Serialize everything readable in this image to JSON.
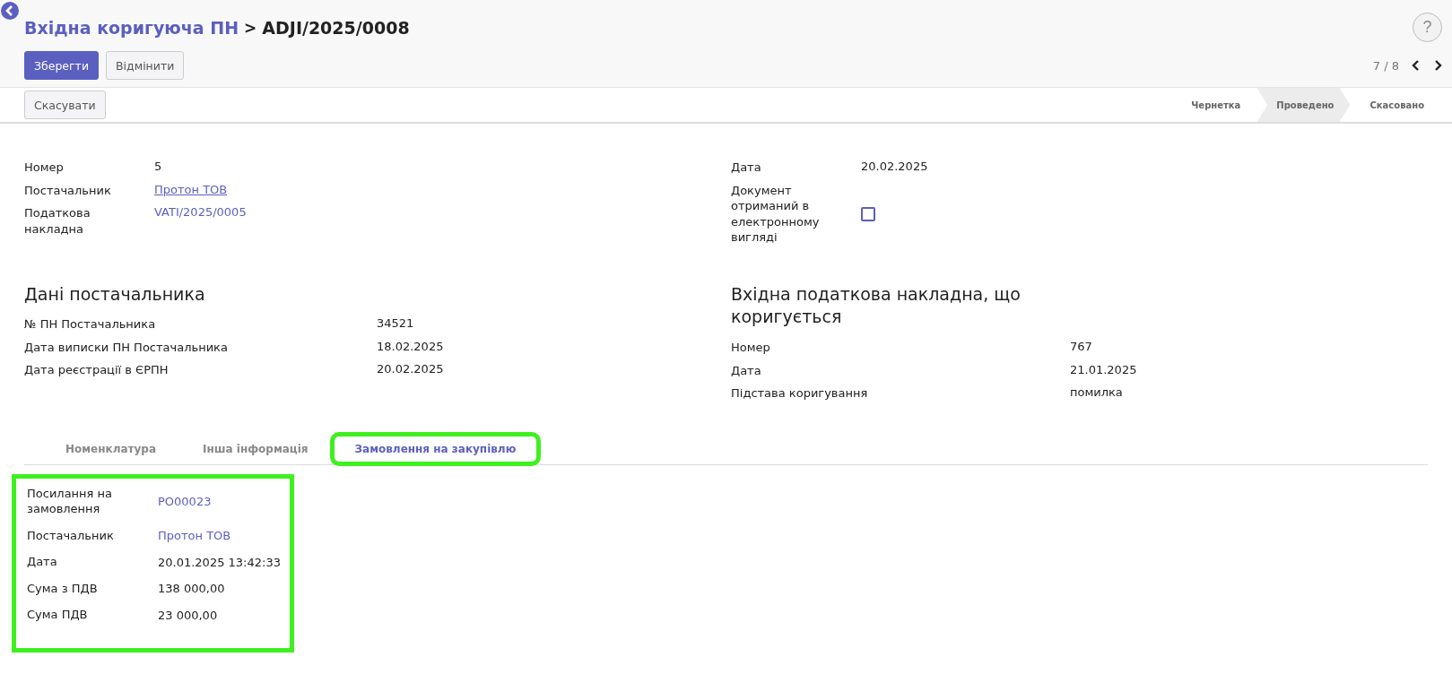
{
  "breadcrumb": {
    "parent": "Вхідна коригуюча ПН",
    "separator": ">",
    "current": "ADJI/2025/0008"
  },
  "buttons": [
    {
      "label": "Зберегти",
      "kind": "primary"
    },
    {
      "label": "Відмінити",
      "kind": "secondary"
    }
  ],
  "help": "?",
  "pager": {
    "text": "7 / 8"
  },
  "status_button": "Скасувати",
  "stages": [
    {
      "label": "Чернетка",
      "selected": false
    },
    {
      "label": "Проведено",
      "selected": true
    },
    {
      "label": "Скасовано",
      "selected": false
    }
  ],
  "fields_left": [
    {
      "label": "Номер",
      "value": "5",
      "kind": "text"
    },
    {
      "label": "Постачальник",
      "value": "Протон ТОВ",
      "kind": "link"
    },
    {
      "label": "Податкова накладна",
      "value": "VATI/2025/0005",
      "kind": "ref"
    }
  ],
  "fields_right": [
    {
      "label": "Дата",
      "value": "20.02.2025",
      "kind": "text"
    },
    {
      "label": "Документ отриманий в електронному вигляді",
      "checked": false,
      "kind": "checkbox"
    }
  ],
  "supplier_section": {
    "title": "Дані постачальника",
    "fields": [
      {
        "label": "№ ПН Постачальника",
        "value": "34521"
      },
      {
        "label": "Дата виписки ПН Постачальника",
        "value": "18.02.2025"
      },
      {
        "label": "Дата реєстрації в ЄРПН",
        "value": "20.02.2025"
      }
    ]
  },
  "corrected_section": {
    "title": "Вхідна податкова накладна, що коригується",
    "fields": [
      {
        "label": "Номер",
        "value": "767"
      },
      {
        "label": "Дата",
        "value": "21.01.2025"
      },
      {
        "label": "Підстава коригування",
        "value": "помилка"
      }
    ]
  },
  "tabs": [
    {
      "label": "Номенклатура",
      "selected": false,
      "highlighted": false
    },
    {
      "label": "Інша інформація",
      "selected": false,
      "highlighted": false
    },
    {
      "label": "Замовлення на закупівлю",
      "selected": true,
      "highlighted": true
    }
  ],
  "order_panel": {
    "highlighted": true,
    "fields": [
      {
        "label": "Посилання на замовлення",
        "value": "PO00023",
        "kind": "ref"
      },
      {
        "label": "Постачальник",
        "value": "Протон ТОВ",
        "kind": "ref"
      },
      {
        "label": "Дата",
        "value": "20.01.2025 13:42:33",
        "kind": "text"
      },
      {
        "label": "Сума з ПДВ",
        "value": "138 000,00",
        "kind": "text"
      },
      {
        "label": "Сума ПДВ",
        "value": "23 000,00",
        "kind": "text"
      }
    ]
  }
}
